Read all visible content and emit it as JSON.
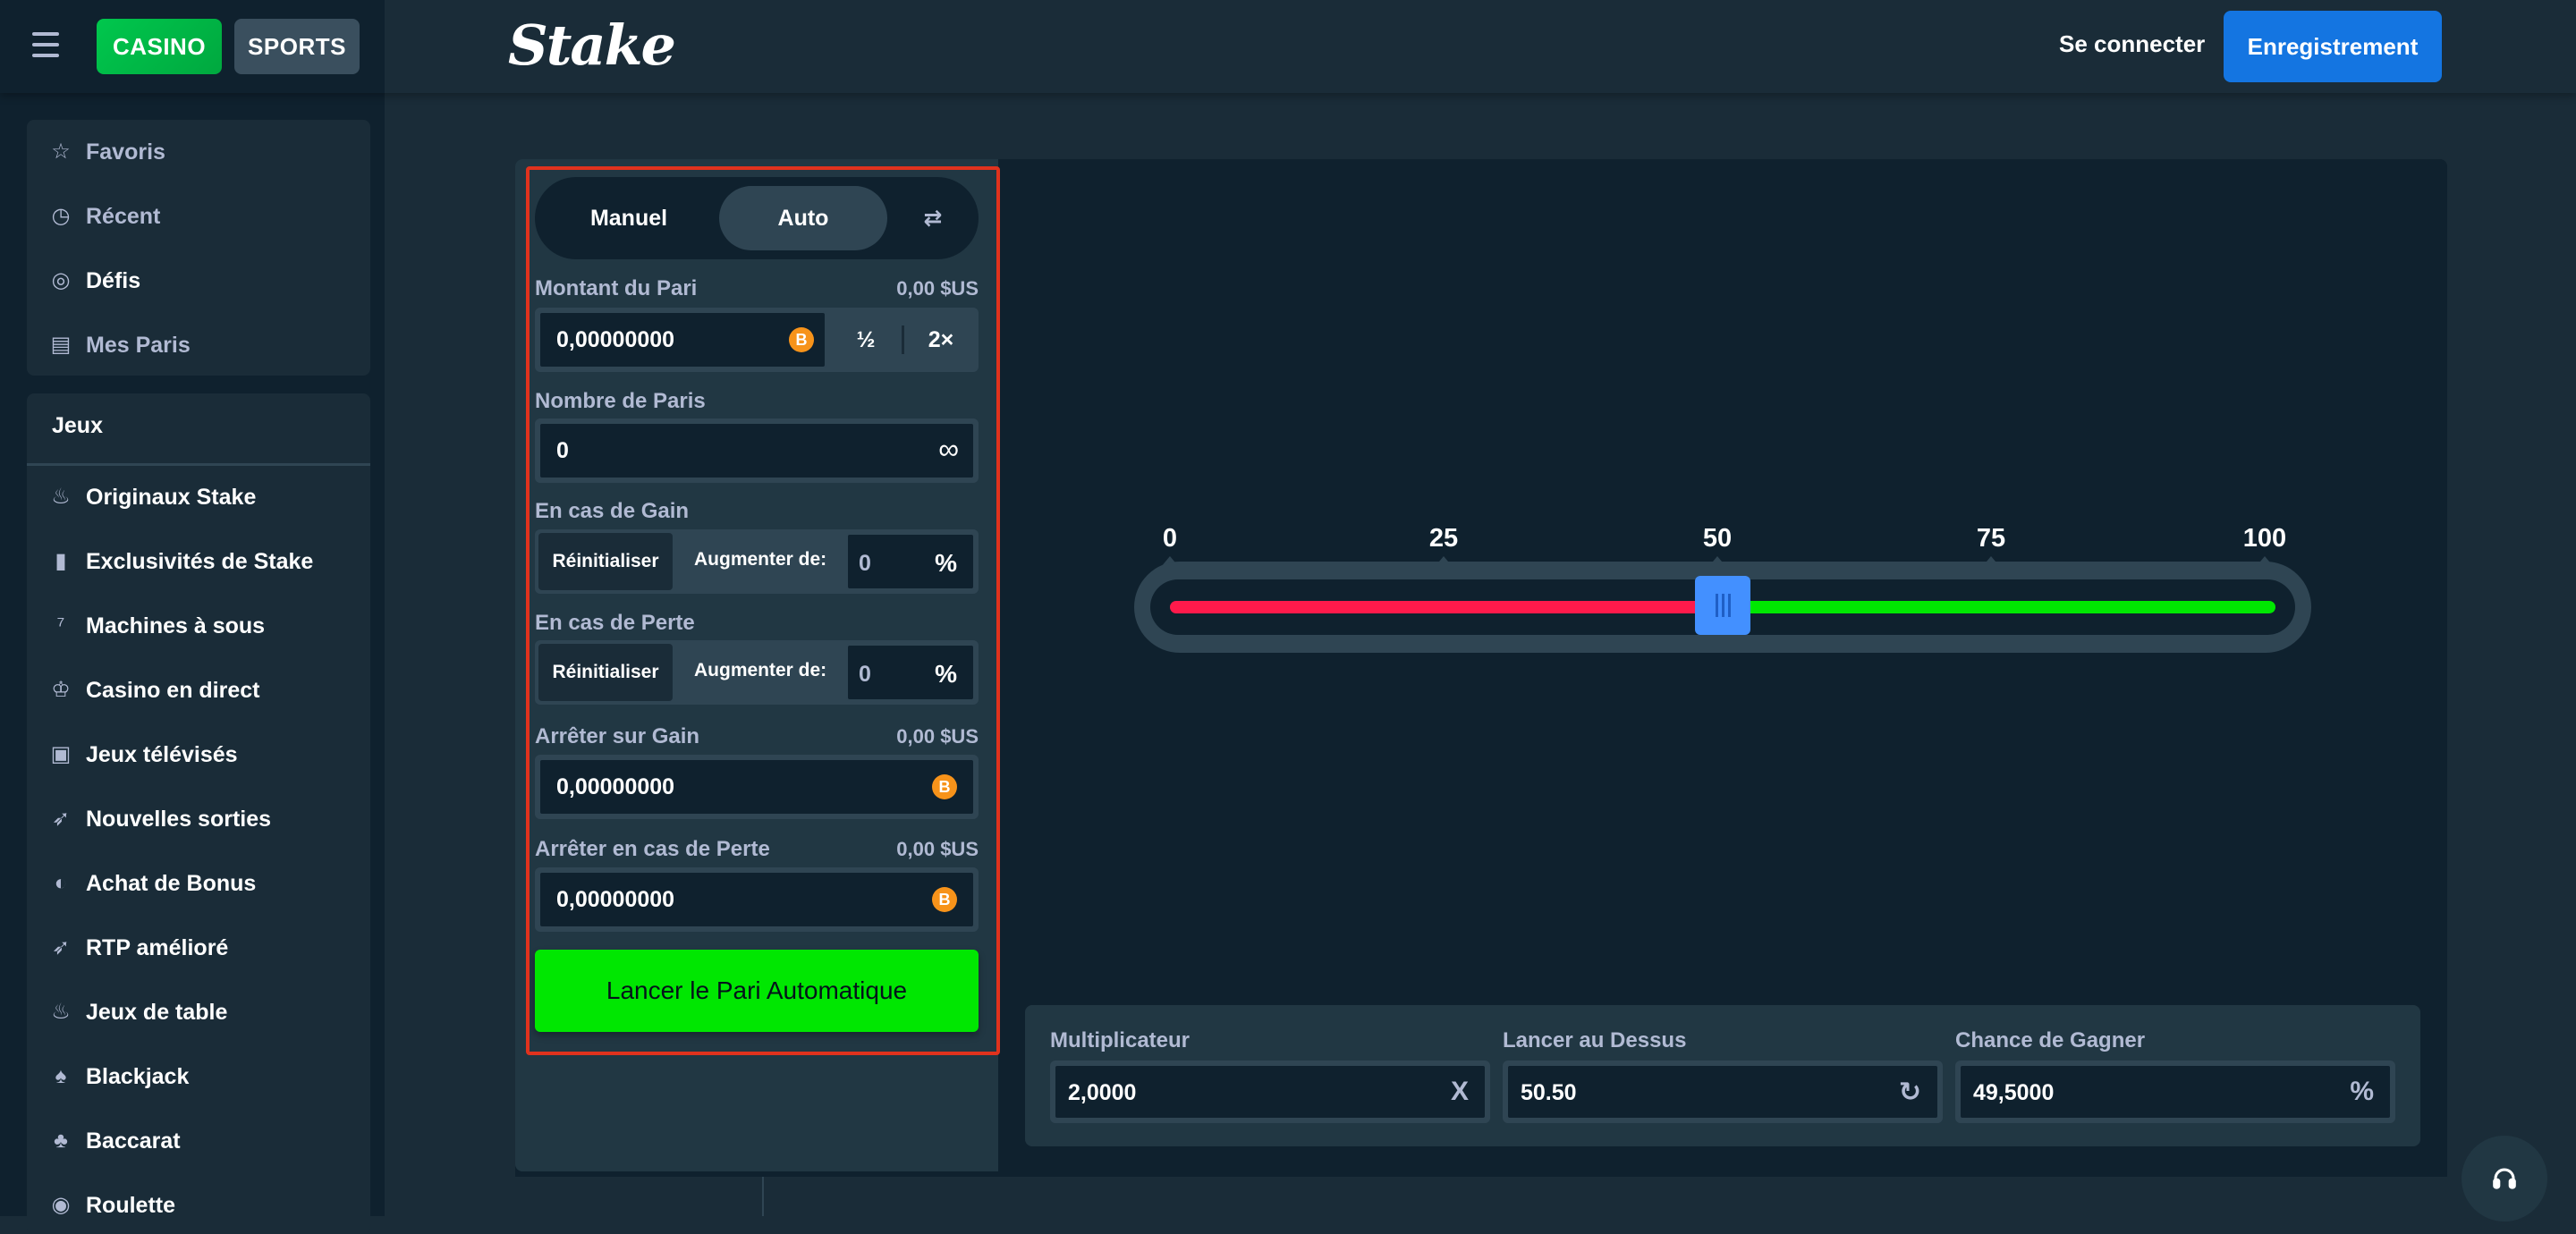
{
  "header": {
    "casino_tab": "CASINO",
    "sports_tab": "SPORTS",
    "logo": "Stake",
    "login": "Se connecter",
    "register": "Enregistrement"
  },
  "sidebar": {
    "top_items": [
      {
        "label": "Favoris",
        "icon": "star-icon",
        "muted": true
      },
      {
        "label": "Récent",
        "icon": "history-icon",
        "muted": true
      },
      {
        "label": "Défis",
        "icon": "target-icon",
        "muted": false
      },
      {
        "label": "Mes Paris",
        "icon": "receipt-icon",
        "muted": true
      }
    ],
    "games_title": "Jeux",
    "game_items": [
      {
        "label": "Originaux Stake",
        "icon": "flame-icon"
      },
      {
        "label": "Exclusivités de Stake",
        "icon": "bookmark-icon"
      },
      {
        "label": "Machines à sous",
        "icon": "slots-icon"
      },
      {
        "label": "Casino en direct",
        "icon": "live-casino-icon"
      },
      {
        "label": "Jeux télévisés",
        "icon": "tv-icon"
      },
      {
        "label": "Nouvelles sorties",
        "icon": "rocket-icon"
      },
      {
        "label": "Achat de Bonus",
        "icon": "bonus-icon"
      },
      {
        "label": "RTP amélioré",
        "icon": "rocket-icon"
      },
      {
        "label": "Jeux de table",
        "icon": "flame-icon"
      },
      {
        "label": "Blackjack",
        "icon": "chip-icon"
      },
      {
        "label": "Baccarat",
        "icon": "cards-icon"
      },
      {
        "label": "Roulette",
        "icon": "roulette-icon"
      }
    ]
  },
  "controls": {
    "mode_manual": "Manuel",
    "mode_auto": "Auto",
    "swap_icon": "swap-icon",
    "bet_amount": {
      "label": "Montant du Pari",
      "usd": "0,00 $US",
      "value": "0,00000000",
      "half": "½",
      "double": "2×"
    },
    "num_bets": {
      "label": "Nombre de Paris",
      "value": "0",
      "icon": "infinity-icon"
    },
    "on_win": {
      "label": "En cas de Gain",
      "reset": "Réinitialiser",
      "increase": "Augmenter de:",
      "value": "0",
      "unit": "%"
    },
    "on_loss": {
      "label": "En cas de Perte",
      "reset": "Réinitialiser",
      "increase": "Augmenter de:",
      "value": "0",
      "unit": "%"
    },
    "stop_on_profit": {
      "label": "Arrêter sur Gain",
      "usd": "0,00 $US",
      "value": "0,00000000"
    },
    "stop_on_loss": {
      "label": "Arrêter en cas de Perte",
      "usd": "0,00 $US",
      "value": "0,00000000"
    },
    "launch": "Lancer le Pari Automatique",
    "currency_icon": "bitcoin-icon",
    "currency_glyph": "B"
  },
  "slider": {
    "ticks": [
      "0",
      "25",
      "50",
      "75",
      "100"
    ],
    "min": 0,
    "max": 100,
    "value": 50.5,
    "colors": {
      "lose": "#ff1a4b",
      "win": "#00e701",
      "thumb": "#4390ff"
    }
  },
  "stats": {
    "multiplier": {
      "label": "Multiplicateur",
      "value": "2,0000",
      "suffix": "X"
    },
    "roll_over": {
      "label": "Lancer au Dessus",
      "value": "50.50",
      "suffix": "↻"
    },
    "win_chance": {
      "label": "Chance de Gagner",
      "value": "49,5000",
      "suffix": "%"
    }
  },
  "colors": {
    "accent_green": "#00e701",
    "brand_blue": "#1475e1",
    "highlight_red": "#e0321d"
  }
}
